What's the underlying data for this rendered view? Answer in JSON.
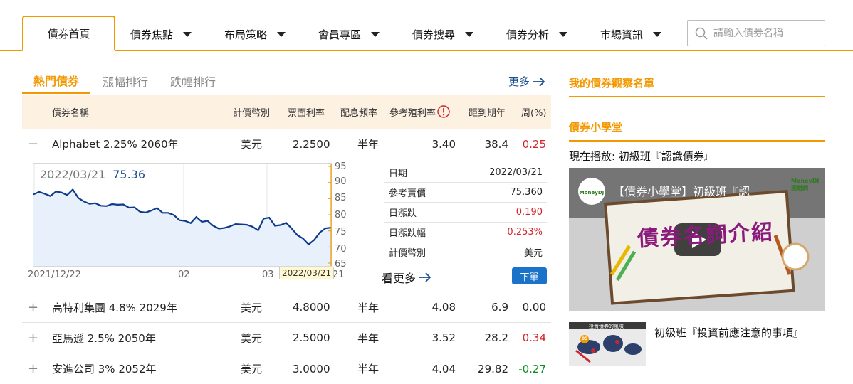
{
  "nav": {
    "tabs": [
      {
        "label": "債券首頁"
      },
      {
        "label": "債券焦點"
      },
      {
        "label": "布局策略"
      },
      {
        "label": "會員專區"
      },
      {
        "label": "債券搜尋"
      },
      {
        "label": "債券分析"
      },
      {
        "label": "市場資訊"
      }
    ],
    "search_placeholder": "請輸入債券名稱"
  },
  "subtabs": [
    "熱門債券",
    "漲幅排行",
    "跌幅排行"
  ],
  "more_label": "更多",
  "table": {
    "headers": [
      "債券名稱",
      "計價幣別",
      "票面利率",
      "配息頻率",
      "參考殖利率",
      "距到期年",
      "周(%)"
    ],
    "rows": [
      {
        "sign": "−",
        "name": "Alphabet 2.25% 2060年",
        "currency": "美元",
        "coupon": "2.2500",
        "freq": "半年",
        "yield": "3.40",
        "years": "38.4",
        "week": "0.25",
        "trend": "up"
      },
      {
        "sign": "+",
        "name": "高特利集團 4.8% 2029年",
        "currency": "美元",
        "coupon": "4.8000",
        "freq": "半年",
        "yield": "4.08",
        "years": "6.9",
        "week": "0.00",
        "trend": "flat"
      },
      {
        "sign": "+",
        "name": "亞馬遜 2.5% 2050年",
        "currency": "美元",
        "coupon": "2.5000",
        "freq": "半年",
        "yield": "3.52",
        "years": "28.2",
        "week": "0.34",
        "trend": "up"
      },
      {
        "sign": "+",
        "name": "安進公司 3% 2052年",
        "currency": "美元",
        "coupon": "3.0000",
        "freq": "半年",
        "yield": "4.04",
        "years": "29.82",
        "week": "-0.27",
        "trend": "down"
      }
    ]
  },
  "chart_data": {
    "type": "area",
    "label_date": "2022/03/21",
    "label_price": "75.36",
    "ylim": [
      65,
      95
    ],
    "yticks": [
      "95",
      "90",
      "85",
      "80",
      "75",
      "70",
      "65"
    ],
    "xticks": [
      "2021/12/22",
      "02",
      "03",
      "21"
    ],
    "tooltip": "2022/03/21",
    "values": [
      86.3,
      87.1,
      86.5,
      85.8,
      87.2,
      86.9,
      86.1,
      87.8,
      85.2,
      84.1,
      83.4,
      83.6,
      82.8,
      82.7,
      83.3,
      83.1,
      83.2,
      82.2,
      82.3,
      80.9,
      80.7,
      81.3,
      82.1,
      80.6,
      80.6,
      79.9,
      78.3,
      78.1,
      77.4,
      79.3,
      77.8,
      78.1,
      76.6,
      75.7,
      75.9,
      76.4,
      77.1,
      77.0,
      76.9,
      76.3,
      75.2,
      78.8,
      79.1,
      76.6,
      76.8,
      77.5,
      75.7,
      73.7,
      72.6,
      70.8,
      72.2,
      74.5,
      75.8,
      76.0
    ],
    "line_color": "#0d3b8c",
    "fill_color": "#e8f0fb"
  },
  "detail": [
    {
      "label": "日期",
      "value": "2022/03/21",
      "color": "#222"
    },
    {
      "label": "參考賣價",
      "value": "75.360",
      "color": "#222"
    },
    {
      "label": "日漲跌",
      "value": "0.190",
      "color": "#d0252b"
    },
    {
      "label": "日漲跌幅",
      "value": "0.253%",
      "color": "#d0252b"
    },
    {
      "label": "計價幣別",
      "value": "美元",
      "color": "#222"
    }
  ],
  "see_more_label": "看更多",
  "order_label": "下單",
  "sidebar": {
    "watchlist_title": "我的債券觀察名單",
    "school_title": "債券小學堂",
    "now_playing": "現在播放: 初級班『認識債券』",
    "video_title": "【債券小學堂】初級班『認",
    "video_banner": "債券名詞介紹",
    "video_brand": "MoneyDJ 理財網",
    "lesson_title": "初級班『投資前應注意的事項』",
    "thumb_caption": "投資債券的風險",
    "thumb_badge": "05"
  },
  "colors": {
    "accent": "#f39800",
    "link": "#1d4e8f",
    "up": "#d0252b",
    "down": "#0b8f22",
    "button": "#1a73c8"
  }
}
